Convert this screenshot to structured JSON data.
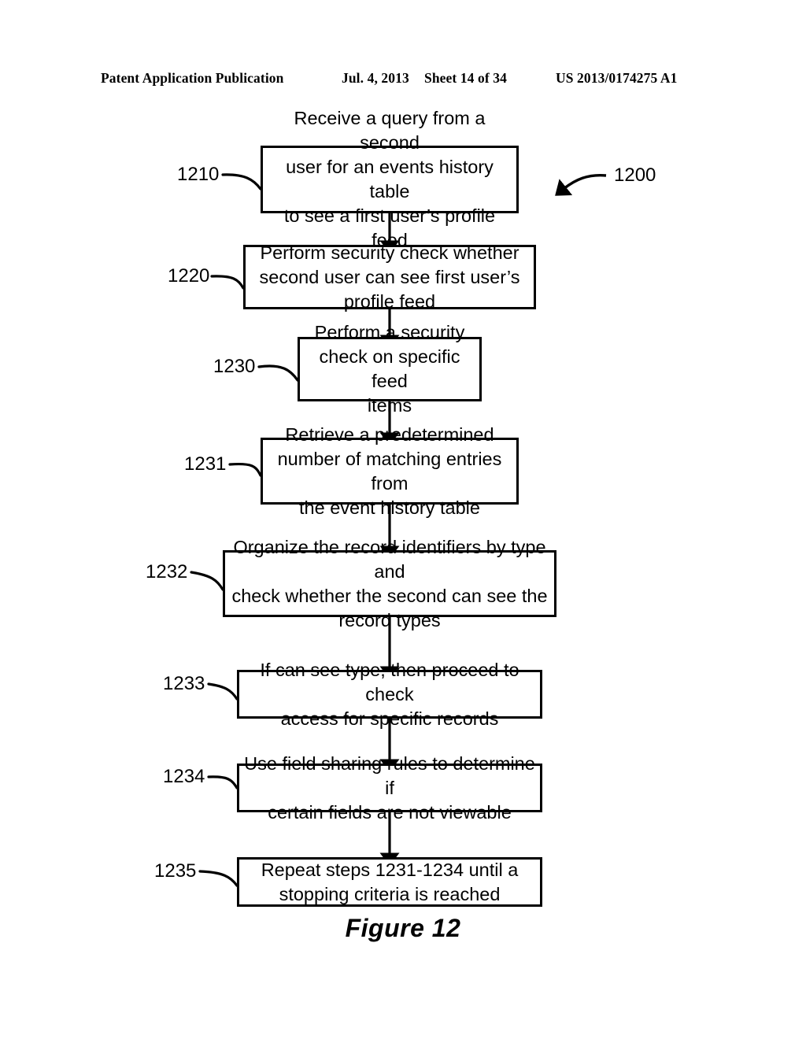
{
  "header": {
    "publication": "Patent Application Publication",
    "date": "Jul. 4, 2013",
    "sheet": "Sheet 14 of 34",
    "patent_number": "US 2013/0174275 A1"
  },
  "figure": {
    "caption": "Figure 12",
    "diagram_ref": "1200"
  },
  "flowchart": {
    "type": "flowchart",
    "orientation": "top-to-bottom",
    "nodes": [
      {
        "ref": "1210",
        "text": "Receive a query from a second\nuser for an events history table\nto see a first user’s profile feed"
      },
      {
        "ref": "1220",
        "text": "Perform security check whether\nsecond user can see first user’s\nprofile feed"
      },
      {
        "ref": "1230",
        "text": "Perform a security\ncheck on specific feed\nitems"
      },
      {
        "ref": "1231",
        "text": "Retrieve a predetermined\nnumber of matching entries from\nthe event history table"
      },
      {
        "ref": "1232",
        "text": "Organize the record identifiers by type and\ncheck whether the second can see the\nrecord types"
      },
      {
        "ref": "1233",
        "text": "If can see type, then proceed to check\naccess for specific records"
      },
      {
        "ref": "1234",
        "text": "Use field sharing rules to determine if\ncertain fields are not viewable"
      },
      {
        "ref": "1235",
        "text": "Repeat steps 1231-1234 until a\nstopping criteria is reached"
      }
    ]
  },
  "colors": {
    "stroke": "#000000",
    "background": "#ffffff",
    "text": "#000000"
  }
}
